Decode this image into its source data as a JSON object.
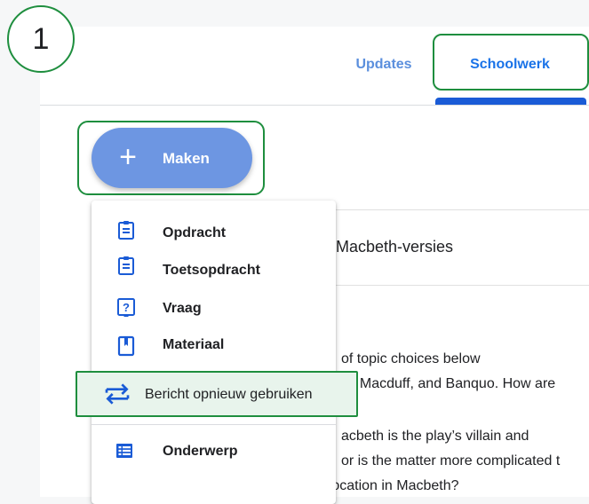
{
  "step_badge": "1",
  "tabs": [
    {
      "label": "Updates",
      "selected": false
    },
    {
      "label": "Schoolwerk",
      "selected": true
    }
  ],
  "create_button": {
    "label": "Maken",
    "icon": "plus-icon"
  },
  "card": {
    "title": "Macbeth-versies"
  },
  "body_lines": [
    "of topic choices below",
    ", Macduff, and Banquo. How are",
    "acbeth is the play’s villain and",
    "or is the matter more complicated t",
    "- What is the significance of equivocation in Macbeth?"
  ],
  "menu": {
    "items": [
      {
        "label": "Opdracht",
        "icon": "assignment-icon"
      },
      {
        "label": "Toetsopdracht",
        "icon": "quiz-assignment-icon"
      },
      {
        "label": "Vraag",
        "icon": "question-icon"
      },
      {
        "label": "Materiaal",
        "icon": "material-icon"
      },
      {
        "label": "Bericht opnieuw gebruiken",
        "icon": "reuse-post-icon"
      },
      {
        "label": "Onderwerp",
        "icon": "topic-icon"
      }
    ]
  },
  "colors": {
    "highlight": "#1e8e3e",
    "accent": "#1a73e8",
    "fab": "#6d96e2",
    "icon": "#1a5bd6"
  }
}
